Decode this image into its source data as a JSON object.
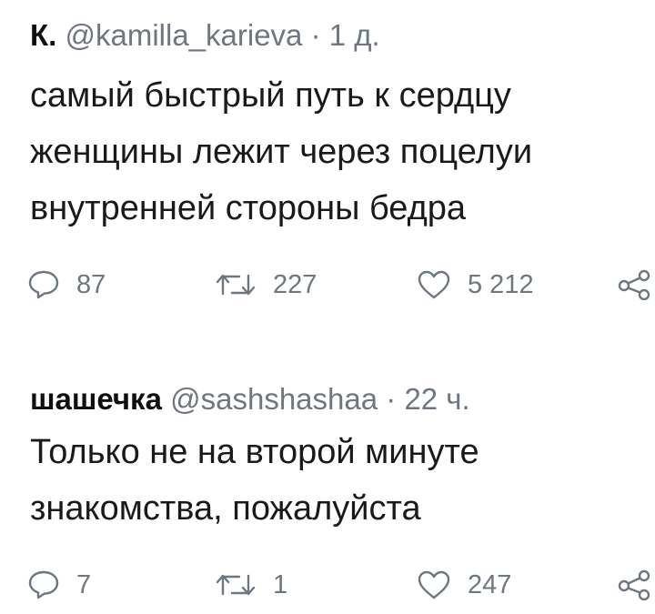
{
  "tweets": [
    {
      "name": "К.",
      "handle": "@kamilla_karieva",
      "separator": "·",
      "time": "1 д.",
      "text_lines": [
        "самый быстрый путь к сердцу",
        "женщины лежит через поцелуи",
        "внутренней стороны бедра"
      ],
      "replies": "87",
      "retweets": "227",
      "likes": "5 212"
    },
    {
      "name": "шашечка",
      "handle": "@sashshashaa",
      "separator": "·",
      "time": "22 ч.",
      "text_lines": [
        "Только не на второй минуте",
        "знакомства, пожалуйста"
      ],
      "replies": "7",
      "retweets": "1",
      "likes": "247"
    }
  ],
  "icons": {
    "reply": "reply-icon",
    "retweet": "retweet-icon",
    "like": "heart-icon",
    "share": "share-icon"
  },
  "colors": {
    "text": "#1a1a1a",
    "secondary": "#6e7780",
    "icon": "#6e7780"
  }
}
